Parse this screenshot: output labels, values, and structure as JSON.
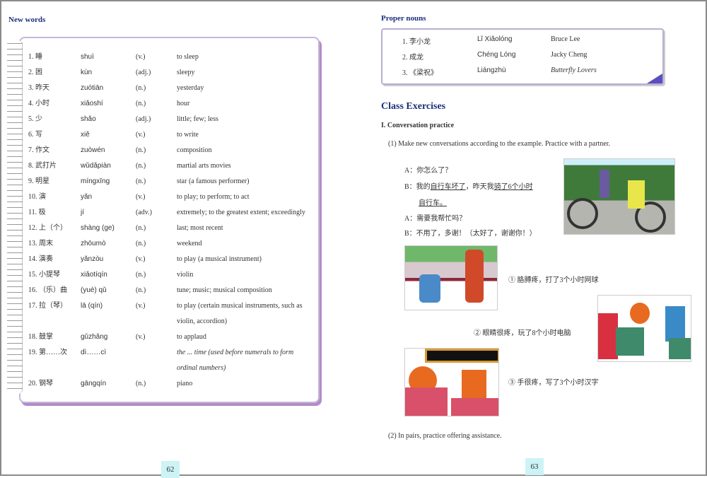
{
  "left_page": {
    "heading": "New words",
    "words": [
      {
        "n": "1. 睡",
        "py": "shuì",
        "pos": "(v.)",
        "en": "to sleep"
      },
      {
        "n": "2. 困",
        "py": "kùn",
        "pos": "(adj.)",
        "en": "sleepy"
      },
      {
        "n": "3. 昨天",
        "py": "zuótiān",
        "pos": "(n.)",
        "en": "yesterday"
      },
      {
        "n": "4. 小时",
        "py": "xiǎoshí",
        "pos": "(n.)",
        "en": "hour"
      },
      {
        "n": "5. 少",
        "py": "shǎo",
        "pos": "(adj.)",
        "en": "little; few; less"
      },
      {
        "n": "6. 写",
        "py": "xiě",
        "pos": "(v.)",
        "en": "to write"
      },
      {
        "n": "7. 作文",
        "py": "zuòwén",
        "pos": "(n.)",
        "en": "composition"
      },
      {
        "n": "8. 武打片",
        "py": "wǔdǎpiàn",
        "pos": "(n.)",
        "en": "martial arts movies"
      },
      {
        "n": "9. 明星",
        "py": "míngxīng",
        "pos": "(n.)",
        "en": "star (a famous performer)"
      },
      {
        "n": "10. 演",
        "py": "yǎn",
        "pos": "(v.)",
        "en": "to play; to perform; to act"
      },
      {
        "n": "11. 极",
        "py": "jí",
        "pos": "(adv.)",
        "en": "extremely; to the greatest extent; exceedingly"
      },
      {
        "n": "12. 上（个）",
        "py": "shàng (ge)",
        "pos": "(n.)",
        "en": "last; most recent"
      },
      {
        "n": "13. 周末",
        "py": "zhōumò",
        "pos": "(n.)",
        "en": "weekend"
      },
      {
        "n": "14. 演奏",
        "py": "yǎnzòu",
        "pos": "(v.)",
        "en": "to play (a musical instrument)"
      },
      {
        "n": "15. 小提琴",
        "py": "xiǎotíqín",
        "pos": "(n.)",
        "en": "violin"
      },
      {
        "n": "16. （乐）曲",
        "py": "(yuè) qǔ",
        "pos": "(n.)",
        "en": "tune; music; musical composition"
      },
      {
        "n": "17. 拉（琴）",
        "py": "lā (qín)",
        "pos": "(v.)",
        "en": "to play (certain musical instruments, such as violin, accordion)"
      },
      {
        "n": "18. 鼓掌",
        "py": "gǔzhǎng",
        "pos": "(v.)",
        "en": "to applaud"
      },
      {
        "n": "19. 第……次",
        "py": "dì……cì",
        "pos": "",
        "en": "the ... time (used before numerals to form ordinal numbers)"
      },
      {
        "n": "20. 钢琴",
        "py": "gāngqín",
        "pos": "(n.)",
        "en": "piano"
      }
    ],
    "page_number": "62"
  },
  "right_page": {
    "proper_heading": "Proper nouns",
    "proper": [
      {
        "n": "1. 李小龙",
        "py": "Lǐ Xiǎolóng",
        "en": "Bruce Lee"
      },
      {
        "n": "2. 成龙",
        "py": "Chéng Lóng",
        "en": "Jacky Cheng"
      },
      {
        "n": "3. 《梁祝》",
        "py": "Liángzhù",
        "en": "Butterfly Lovers"
      }
    ],
    "class_heading": "Class Exercises",
    "section1": "I. Conversation practice",
    "instruction1": "(1) Make new conversations according to the example. Practice with a partner.",
    "dialogue": [
      "A：你怎么了？",
      "B：我的自行车坏了，昨天我骑了6个小时",
      "自行车。",
      "A：需要我帮忙吗？",
      "B：不用了，多谢！（太好了，谢谢你！）"
    ],
    "prompts": [
      "① 胳膊疼，打了3个小时网球",
      "② 眼睛很疼，玩了8个小时电脑",
      "③ 手很疼，写了3个小时汉字"
    ],
    "instruction2": "(2) In pairs, practice offering assistance.",
    "page_number": "63"
  }
}
